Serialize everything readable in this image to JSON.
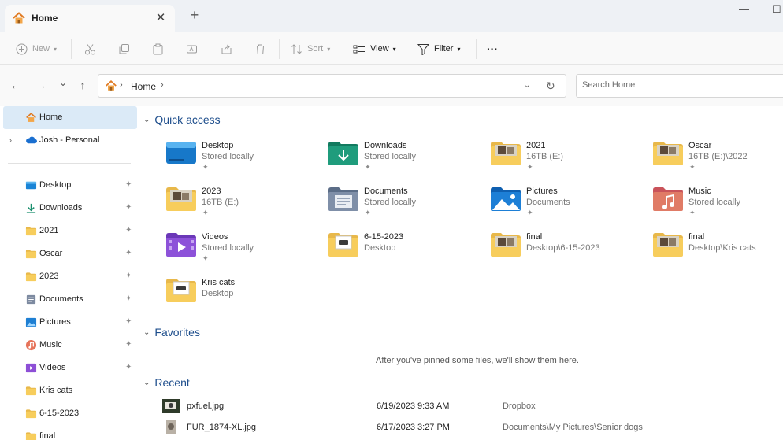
{
  "window": {
    "tab_label": "Home",
    "tab_close": "✕",
    "new_tab": "+",
    "minimize": "—",
    "maximize": "☐"
  },
  "toolbar": {
    "new_label": "New",
    "sort_label": "Sort",
    "view_label": "View",
    "filter_label": "Filter",
    "more_label": "···"
  },
  "nav": {
    "back": "←",
    "forward": "→",
    "recent": "⌄",
    "up": "↑",
    "breadcrumb_sep_1": "›",
    "breadcrumb_home": "Home",
    "breadcrumb_sep_2": "›",
    "address_dropdown": "⌄",
    "refresh": "↻",
    "search_placeholder": "Search Home"
  },
  "sidebar": {
    "home": "Home",
    "onedrive": "Josh - Personal",
    "items": [
      {
        "label": "Desktop",
        "icon": "desktop-icon"
      },
      {
        "label": "Downloads",
        "icon": "downloads-icon"
      },
      {
        "label": "2021",
        "icon": "folder-icon"
      },
      {
        "label": "Oscar",
        "icon": "folder-icon"
      },
      {
        "label": "2023",
        "icon": "folder-icon"
      },
      {
        "label": "Documents",
        "icon": "documents-icon"
      },
      {
        "label": "Pictures",
        "icon": "pictures-icon"
      },
      {
        "label": "Music",
        "icon": "music-icon"
      },
      {
        "label": "Videos",
        "icon": "videos-icon"
      },
      {
        "label": "Kris cats",
        "icon": "folder-icon"
      },
      {
        "label": "6-15-2023",
        "icon": "folder-icon"
      },
      {
        "label": "final",
        "icon": "folder-icon"
      }
    ]
  },
  "quick_access": {
    "title": "Quick access",
    "items": [
      {
        "name": "Desktop",
        "sub": "Stored locally",
        "pinned": true,
        "icon": "desktop-folder-icon"
      },
      {
        "name": "Downloads",
        "sub": "Stored locally",
        "pinned": true,
        "icon": "downloads-folder-icon"
      },
      {
        "name": "2021",
        "sub": "16TB (E:)",
        "pinned": true,
        "icon": "photo-folder-icon"
      },
      {
        "name": "Oscar",
        "sub": "16TB (E:)\\2022",
        "pinned": true,
        "icon": "photo-folder-icon"
      },
      {
        "name": "2023",
        "sub": "16TB (E:)",
        "pinned": true,
        "icon": "photo-folder-icon"
      },
      {
        "name": "Documents",
        "sub": "Stored locally",
        "pinned": true,
        "icon": "documents-folder-icon"
      },
      {
        "name": "Pictures",
        "sub": "Documents",
        "pinned": true,
        "icon": "pictures-folder-icon"
      },
      {
        "name": "Music",
        "sub": "Stored locally",
        "pinned": true,
        "icon": "music-folder-icon"
      },
      {
        "name": "Videos",
        "sub": "Stored locally",
        "pinned": true,
        "icon": "videos-folder-icon"
      },
      {
        "name": "6-15-2023",
        "sub": "Desktop",
        "pinned": false,
        "icon": "doc-folder-icon"
      },
      {
        "name": "final",
        "sub": "Desktop\\6-15-2023",
        "pinned": false,
        "icon": "photo-folder-icon"
      },
      {
        "name": "final",
        "sub": "Desktop\\Kris cats",
        "pinned": false,
        "icon": "photo-folder-icon"
      },
      {
        "name": "Kris cats",
        "sub": "Desktop",
        "pinned": false,
        "icon": "doc-folder-icon"
      }
    ]
  },
  "favorites": {
    "title": "Favorites",
    "empty_message": "After you've pinned some files, we'll show them here."
  },
  "recent": {
    "title": "Recent",
    "items": [
      {
        "name": "pxfuel.jpg",
        "date": "6/19/2023 9:33 AM",
        "location": "Dropbox"
      },
      {
        "name": "FUR_1874-XL.jpg",
        "date": "6/17/2023 3:27 PM",
        "location": "Documents\\My Pictures\\Senior dogs"
      }
    ]
  },
  "pin_glyph": "📌"
}
